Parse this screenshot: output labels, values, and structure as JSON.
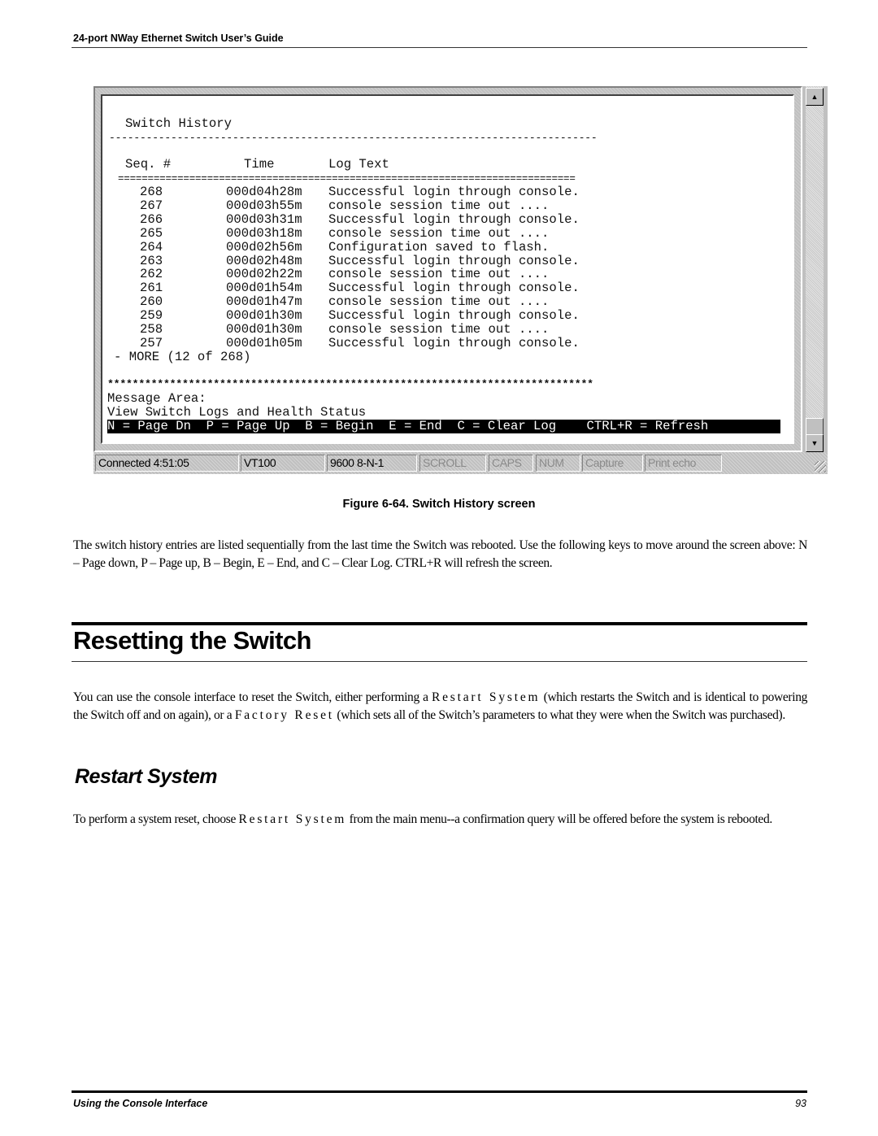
{
  "running_header": "24-port NWay Ethernet Switch User’s Guide",
  "terminal": {
    "screen_title": "Switch History",
    "title_rule": "-------------------------------------------------------------------------------",
    "columns": {
      "seq": "Seq. #",
      "time": "Time",
      "log": "Log Text"
    },
    "column_rule": "=============================================================================",
    "rows": [
      {
        "seq": "268",
        "time": "000d04h28m",
        "log": "Successful login through console."
      },
      {
        "seq": "267",
        "time": "000d03h55m",
        "log": "console session time out ...."
      },
      {
        "seq": "266",
        "time": "000d03h31m",
        "log": "Successful login through console."
      },
      {
        "seq": "265",
        "time": "000d03h18m",
        "log": "console session time out ...."
      },
      {
        "seq": "264",
        "time": "000d02h56m",
        "log": "Configuration saved to flash."
      },
      {
        "seq": "263",
        "time": "000d02h48m",
        "log": "Successful login through console."
      },
      {
        "seq": "262",
        "time": "000d02h22m",
        "log": "console session time out ...."
      },
      {
        "seq": "261",
        "time": "000d01h54m",
        "log": "Successful login through console."
      },
      {
        "seq": "260",
        "time": "000d01h47m",
        "log": "console session time out ...."
      },
      {
        "seq": "259",
        "time": "000d01h30m",
        "log": "Successful login through console."
      },
      {
        "seq": "258",
        "time": "000d01h30m",
        "log": "console session time out ...."
      },
      {
        "seq": "257",
        "time": "000d01h05m",
        "log": "Successful login through console."
      }
    ],
    "more_line": "- MORE (12 of 268)",
    "star_rule": "******************************************************************************",
    "message_area_label": "Message Area:",
    "message_text": "View Switch Logs and Health Status",
    "key_bar": "N = Page Dn  P = Page Up  B = Begin  E = End  C = Clear Log    CTRL+R = Refresh",
    "scroll_up_icon": "▲",
    "scroll_down_icon": "▼",
    "status_bar": {
      "connected": "Connected 4:51:05",
      "emulation": "VT100",
      "port_settings": "9600 8-N-1",
      "scroll": "SCROLL",
      "caps": "CAPS",
      "num": "NUM",
      "capture": "Capture",
      "print_echo": "Print echo"
    }
  },
  "figure_caption": "Figure 6-64.  Switch History screen",
  "intro_paragraph": "The switch history entries are listed sequentially from the last time the Switch was rebooted. Use the following keys to move around the screen above: N – Page down, P – Page up, B – Begin, E – End, and C – Clear Log. CTRL+R will refresh the screen.",
  "section": {
    "title": "Resetting the Switch",
    "para": {
      "part1": "You can use the console interface to reset the Switch, either performing a ",
      "term1": "Restart System",
      "part2": " (which restarts the Switch and is identical to powering the Switch off and on again), or a ",
      "term2": "Factory Reset",
      "part3": " (which sets all of the Switch’s parameters to what they were when the Switch was purchased)."
    }
  },
  "subsection": {
    "title": "Restart System",
    "para": {
      "part1": "To perform a system reset, choose ",
      "term1": "Restart System",
      "part2": " from the main menu--a confirmation query will be offered before the system is rebooted."
    }
  },
  "footer": {
    "chapter": "Using the Console Interface",
    "page_number": "93"
  }
}
